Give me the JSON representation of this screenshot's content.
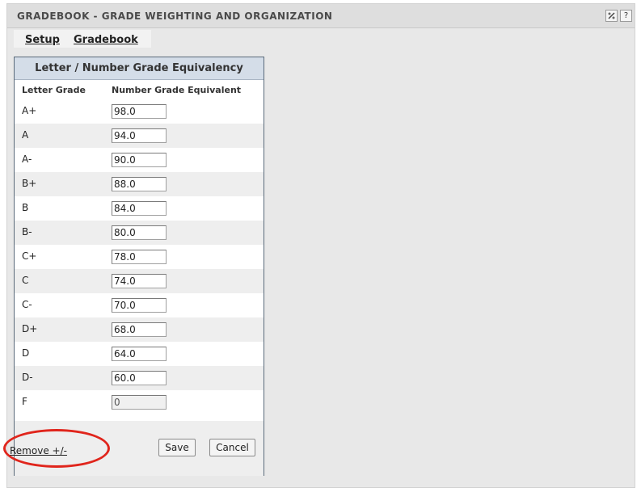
{
  "header": {
    "title": "GRADEBOOK - GRADE WEIGHTING AND ORGANIZATION",
    "help_label": "?"
  },
  "tabs": [
    {
      "label": "Setup"
    },
    {
      "label": "Gradebook"
    }
  ],
  "panel": {
    "title": "Letter / Number Grade Equivalency",
    "col_letter": "Letter Grade",
    "col_number": "Number Grade Equivalent"
  },
  "grades": [
    {
      "letter": "A+",
      "value": "98.0"
    },
    {
      "letter": "A",
      "value": "94.0"
    },
    {
      "letter": "A-",
      "value": "90.0"
    },
    {
      "letter": "B+",
      "value": "88.0"
    },
    {
      "letter": "B",
      "value": "84.0"
    },
    {
      "letter": "B-",
      "value": "80.0"
    },
    {
      "letter": "C+",
      "value": "78.0"
    },
    {
      "letter": "C",
      "value": "74.0"
    },
    {
      "letter": "C-",
      "value": "70.0"
    },
    {
      "letter": "D+",
      "value": "68.0"
    },
    {
      "letter": "D",
      "value": "64.0"
    },
    {
      "letter": "D-",
      "value": "60.0"
    },
    {
      "letter": "F",
      "value": "0"
    }
  ],
  "footer": {
    "remove_label": "Remove +/-",
    "save_label": "Save",
    "cancel_label": "Cancel"
  },
  "colors": {
    "highlight_circle": "#e0251c",
    "panel_header": "#d4dde8"
  }
}
